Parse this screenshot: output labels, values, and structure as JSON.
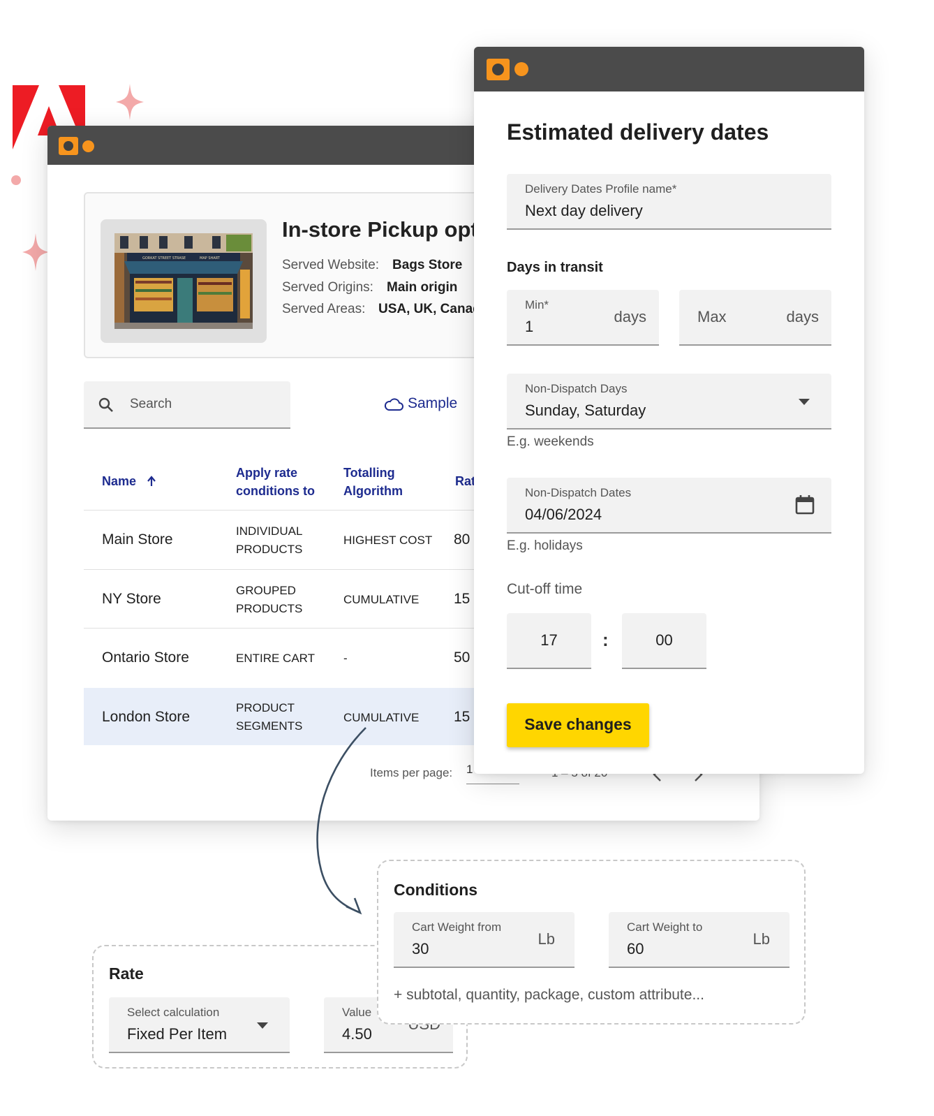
{
  "colors": {
    "accent_orange": "#f7941d",
    "titlebar": "#4b4b4b",
    "link_blue": "#1d2b8f",
    "save_yellow": "#ffd600",
    "adobe_red": "#ed1c24",
    "sparkle_pink": "#f3a9a9",
    "selected_row": "#e8eef9"
  },
  "icons": {
    "brand": "adobe-logo",
    "search": "search-icon",
    "cloud": "cloud-icon",
    "sort": "arrow-up-icon",
    "dropdown": "chevron-down-icon",
    "calendar": "calendar-icon",
    "prev": "chevron-left-icon",
    "next": "chevron-right-icon"
  },
  "back_window": {
    "card": {
      "title": "In-store Pickup opti",
      "rows": [
        {
          "label": "Served Website:",
          "value": "Bags Store"
        },
        {
          "label": "Served Origins:",
          "value": "Main origin"
        },
        {
          "label": "Served Areas:",
          "value": "USA, UK, Canad"
        }
      ],
      "store_sign_left": "GORKAT STREET STRASE",
      "store_sign_right": "MAP SHART"
    },
    "search": {
      "placeholder": "Search"
    },
    "sample_label": "Sample",
    "table": {
      "headers": {
        "name": "Name",
        "apply_line1": "Apply rate",
        "apply_line2": "conditions to",
        "total_line1": "Totalling",
        "total_line2": "Algorithm",
        "rate": "Rat"
      },
      "rows": [
        {
          "name": "Main Store",
          "apply1": "INDIVIDUAL",
          "apply2": "PRODUCTS",
          "algo": "HIGHEST COST",
          "rate": "80"
        },
        {
          "name": "NY Store",
          "apply1": "GROUPED",
          "apply2": "PRODUCTS",
          "algo": "CUMULATIVE",
          "rate": "15"
        },
        {
          "name": "Ontario Store",
          "apply1": "ENTIRE CART",
          "apply2": "",
          "algo": "-",
          "rate": "50"
        },
        {
          "name": "London Store",
          "apply1": "PRODUCT",
          "apply2": "SEGMENTS",
          "algo": "CUMULATIVE",
          "rate": "15"
        }
      ]
    },
    "pagination": {
      "label": "Items per page:",
      "value": "1",
      "range": "1 – 5 of 20"
    }
  },
  "front_window": {
    "title": "Estimated delivery dates",
    "profile": {
      "label": "Delivery Dates Profile name*",
      "value": "Next day delivery"
    },
    "transit_heading": "Days in transit",
    "min": {
      "label": "Min*",
      "value": "1",
      "suffix": "days"
    },
    "max": {
      "placeholder": "Max",
      "suffix": "days"
    },
    "non_dispatch_days": {
      "label": "Non-Dispatch Days",
      "value": "Sunday, Saturday",
      "hint": "E.g. weekends"
    },
    "non_dispatch_dates": {
      "label": "Non-Dispatch Dates",
      "value": "04/06/2024",
      "hint": "E.g. holidays"
    },
    "cutoff": {
      "label": "Cut-off time",
      "hours": "17",
      "separator": ":",
      "minutes": "00"
    },
    "save_label": "Save changes"
  },
  "conditions_panel": {
    "title": "Conditions",
    "from": {
      "label": "Cart Weight from",
      "value": "30",
      "suffix": "Lb"
    },
    "to": {
      "label": "Cart Weight to",
      "value": "60",
      "suffix": "Lb"
    },
    "more": "+ subtotal, quantity, package, custom attribute..."
  },
  "rate_panel": {
    "title": "Rate",
    "calc": {
      "label": "Select calculation",
      "value": "Fixed Per Item"
    },
    "value": {
      "label": "Value",
      "value": "4.50",
      "suffix": "USD"
    }
  }
}
